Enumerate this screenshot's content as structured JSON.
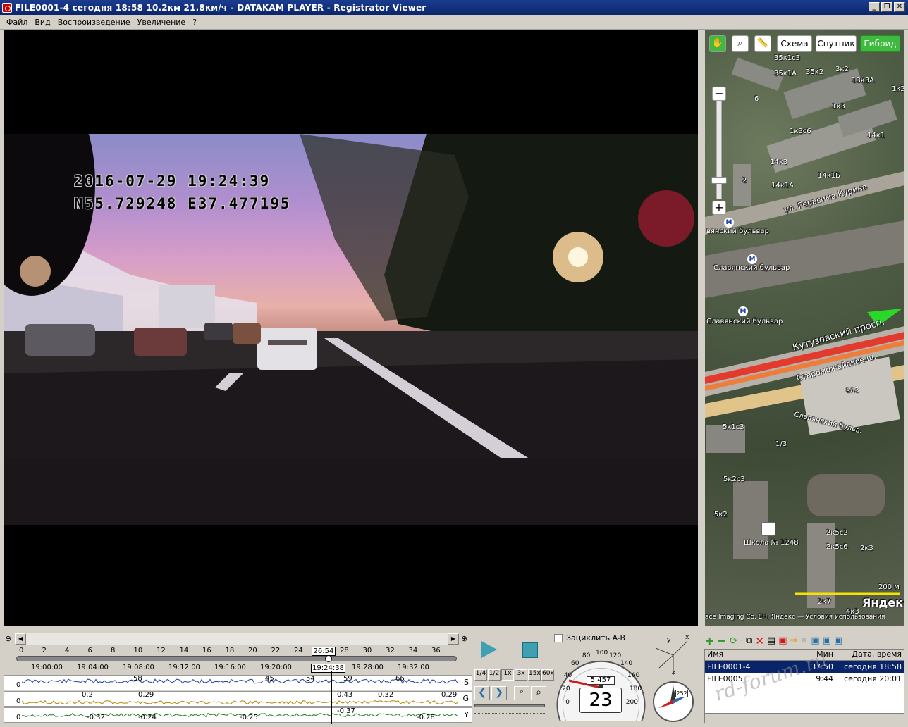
{
  "window": {
    "title": "FILE0001-4    сегодня 18:58    10.2км    21.8км/ч  -  DATAKAM PLAYER - Registrator Viewer",
    "buttons": [
      "_",
      "❐",
      "✕"
    ]
  },
  "menu": [
    "Файл",
    "Вид",
    "Воспроизведение",
    "Увеличение",
    "?"
  ],
  "video": {
    "osd_datetime": "2016-07-29  19:24:39",
    "osd_coords": "N55.729248  E37.477195"
  },
  "map": {
    "mode_buttons": [
      "Схема",
      "Спутник",
      "Гибрид"
    ],
    "active_mode": "Гибрид",
    "labels": [
      "35к1с3",
      "35к1А",
      "35к2",
      "3к2",
      "13к3А",
      "6",
      "1к2",
      "1к3",
      "1к3с6",
      "14к1",
      "14к3",
      "14к1Б",
      "14к1А",
      "2",
      "ул. Герасима Курина",
      "вянский бульвар",
      "Славянский бульвар",
      "Славянский бульвар",
      "Кутузовский просп.",
      "Староможайское ш.",
      "вл3",
      "Славянский бульв.",
      "5к1с3",
      "1/3",
      "5к2с3",
      "5к2",
      "Школа № 1248",
      "2к5с2",
      "2к5с6",
      "2к3",
      "2к7",
      "4к3"
    ],
    "scale": "200 м",
    "logo": "Яндекс",
    "attribution": "ace Imaging Co.    EH,  Яндекс — Условия использования"
  },
  "timeline": {
    "ticks": [
      "0",
      "2",
      "4",
      "6",
      "8",
      "10",
      "12",
      "14",
      "16",
      "18",
      "20",
      "22",
      "24",
      "26:54",
      "28",
      "30",
      "32",
      "34",
      "36"
    ],
    "times": [
      "19:00:00",
      "19:04:00",
      "19:08:00",
      "19:12:00",
      "19:16:00",
      "19:20:00",
      "19:24:38",
      "19:28:00",
      "19:32:00"
    ],
    "current_marker": "26:54",
    "current_time": "19:24:38"
  },
  "graphs": [
    {
      "axis": "S",
      "zero": "0",
      "values": [
        "58",
        "45",
        "54",
        "59",
        "66"
      ]
    },
    {
      "axis": "G",
      "zero": "0",
      "values": [
        "0.2",
        "0.29",
        "0.43",
        "0.32",
        "0.29"
      ]
    },
    {
      "axis": "Y",
      "zero": "0",
      "values": [
        "-0.32",
        "-0.24",
        "-0.25",
        "-0.37",
        "-0.28"
      ]
    }
  ],
  "playback": {
    "loop_label": "Зациклить A-B",
    "speeds": [
      "1/4",
      "1/2",
      "1x",
      "3x",
      "15x",
      "60x"
    ]
  },
  "speedometer": {
    "scale": [
      "0",
      "20",
      "40",
      "60",
      "80",
      "100",
      "120",
      "140",
      "160",
      "180",
      "200"
    ],
    "odometer": "5 457",
    "speed": "23"
  },
  "compass": {
    "heading": "252"
  },
  "axes_widget": {
    "x": "x",
    "y": "y",
    "z": "z"
  },
  "file_list": {
    "columns": [
      "Имя",
      "Мин",
      "Дата, время"
    ],
    "rows": [
      {
        "name": "FILE0001-4",
        "min": "37:50",
        "date": "сегодня 18:58",
        "selected": true
      },
      {
        "name": "FILE0005",
        "min": "9:44",
        "date": "сегодня 20:01",
        "selected": false
      }
    ]
  },
  "watermark": "rd-forum.ru",
  "colors": {
    "titlebar": "#0a246a",
    "map_active": "#3dbb3d",
    "graph_speed": "#1a3fa8",
    "graph_g": "#b8860b",
    "graph_y": "#1d7a1d"
  }
}
